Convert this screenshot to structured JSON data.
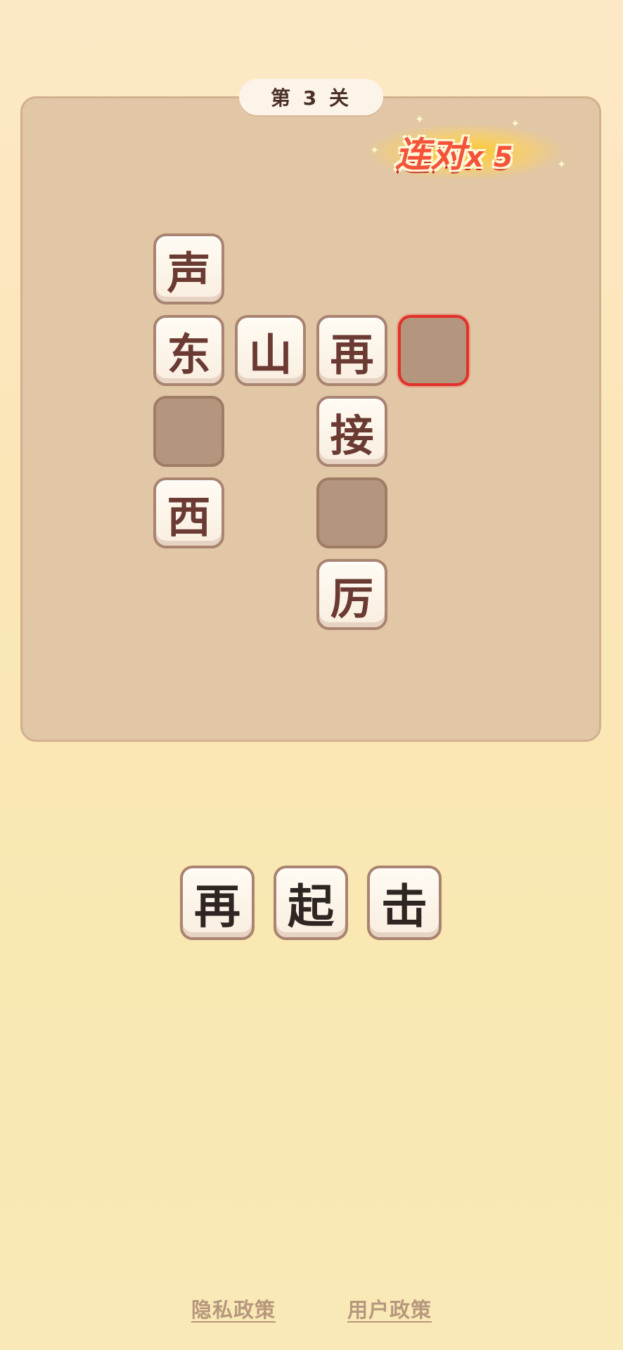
{
  "level": {
    "label": "第 3 关"
  },
  "combo": {
    "text": "连对",
    "multiplier": "x 5"
  },
  "grid": {
    "r0c0": "声",
    "r1c0": "东",
    "r1c1": "山",
    "r1c2": "再",
    "r1c3": "",
    "r2c0": "",
    "r2c2": "接",
    "r3c0": "西",
    "r3c2": "",
    "r4c2": "厉"
  },
  "selected_cell": "r1c3",
  "choices": [
    "再",
    "起",
    "击"
  ],
  "footer": {
    "privacy_label": "隐私政策",
    "user_policy_label": "用户政策"
  },
  "colors": {
    "background": "#fbe6b8",
    "board": "#e2c7a6",
    "tile_text": "#6b3b33",
    "empty_tile": "#b4967f",
    "selected_border": "#e2312a",
    "combo_text": "#f5523a",
    "footer_link": "#b7977d"
  }
}
